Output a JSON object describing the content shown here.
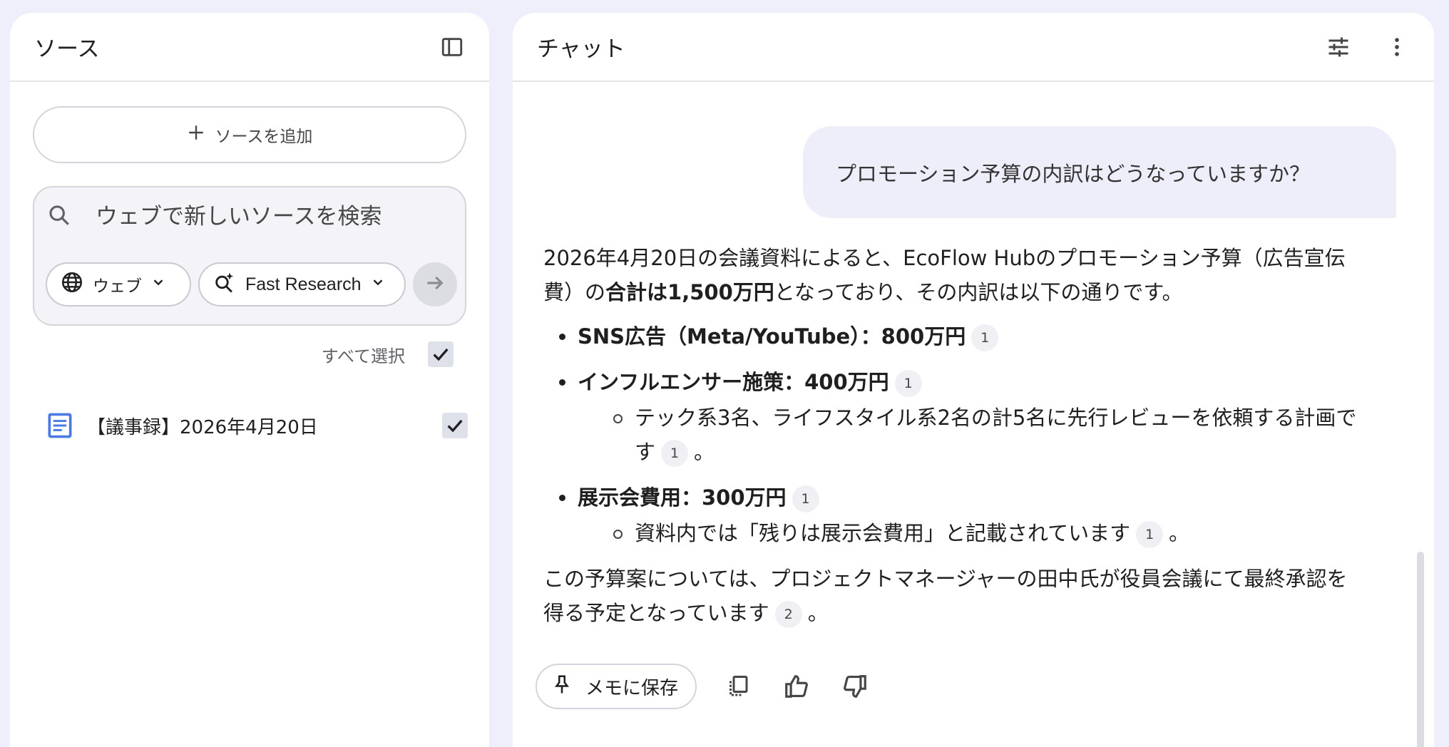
{
  "sources_panel": {
    "title": "ソース",
    "add_source_label": "ソースを追加",
    "search_placeholder": "ウェブで新しいソースを検索",
    "web_chip_label": "ウェブ",
    "research_chip_label": "Fast Research",
    "select_all_label": "すべて選択",
    "items": [
      {
        "label": "【議事録】2026年4月20日",
        "checked": true
      }
    ]
  },
  "chat_panel": {
    "title": "チャット",
    "user_message": "プロモーション予算の内訳はどうなっていますか？",
    "answer": {
      "intro_1": "2026年4月20日の会議資料によると、EcoFlow Hubのプロモーション予算（広告宣伝費）の",
      "intro_bold": "合計は1,500万円",
      "intro_2": "となっており、その内訳は以下の通りです。",
      "bullets": [
        {
          "bold": "SNS広告（Meta/YouTube）：800万円",
          "cite": "1"
        },
        {
          "bold": "インフルエンサー施策：400万円",
          "cite": "1",
          "sub": "テック系3名、ライフスタイル系2名の計5名に先行レビューを依頼する計画です",
          "sub_cite": "1",
          "sub_end": "。"
        },
        {
          "bold": "展示会費用：300万円",
          "cite": "1",
          "sub": "資料内では「残りは展示会費用」と記載されています",
          "sub_cite": "1",
          "sub_end": "。"
        }
      ],
      "conclusion": "この予算案については、プロジェクトマネージャーの田中氏が役員会議にて最終承認を得る予定となっています",
      "conclusion_cite": "2",
      "conclusion_end": "。"
    },
    "save_memo_label": "メモに保存"
  }
}
